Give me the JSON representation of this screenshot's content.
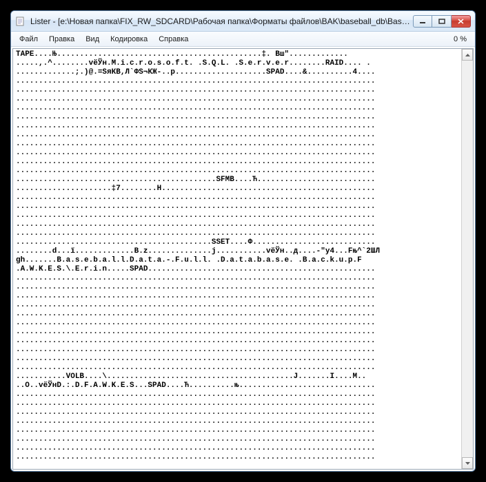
{
  "window": {
    "title": "Lister - [e:\\Новая папка\\FIX_RW_SDCARD\\Рабочая папка\\Форматы файлов\\BAK\\baseball_db\\BaseballD..."
  },
  "menu": {
    "file": "Файл",
    "edit": "Правка",
    "view": "Вид",
    "encoding": "Кодировка",
    "help": "Справка"
  },
  "status": {
    "percent": "0 %"
  },
  "content": {
    "text": "ТАРЕ....Њ.............................................‡. Bш″.............\n.....,.^........vёЎн.M.i.c.r.o.s.o.f.t. .S.Q.L. .S.e.r.v.e.r........RAID.... .\n.............;.)@.=SяКВ,Л`ФS¬КЖ-..р....................SPAD....&..........4....\n...............................................................................\n...............................................................................\n...............................................................................\n...............................................................................\n...............................................................................\n...............................................................................\n...............................................................................\n...............................................................................\n...............................................................................\n...............................................................................\n...............................................................................\n............................................SFMB....Ћ..........................\n.....................‡7........Н...............................................\n...............................................................................\n...............................................................................\n...............................................................................\n...............................................................................\n...............................................................................\n...........................................SSET....Ф...........................\n........d...ї.............B.z..............j...........vёЎн..д....-″у4...Fњ^`2ШЛ\ngh.......B.a.s.e.b.a.l.l.D.a.t.a.-.F.u.l.l. .D.a.t.a.b.a.s.e. .B.a.c.k.u.p.F\n.A.W.K.E.S.\\.E.r.i.n.....SPAD..................................................\n...............................................................................\n...............................................................................\n...............................................................................\n...............................................................................\n...............................................................................\n...............................................................................\n...............................................................................\n...............................................................................\n...............................................................................\n...............................................................................\n...............................................................................\n...........VOLB....\\.........................................J.......I....M..\n..O..vёЎнD.:.D.F.A.W.K.E.S...SPAD....Ћ..........њ..............................\n...............................................................................\n...............................................................................\n...............................................................................\n...............................................................................\n...............................................................................\n...............................................................................\n...............................................................................\n..............................................................................."
  }
}
